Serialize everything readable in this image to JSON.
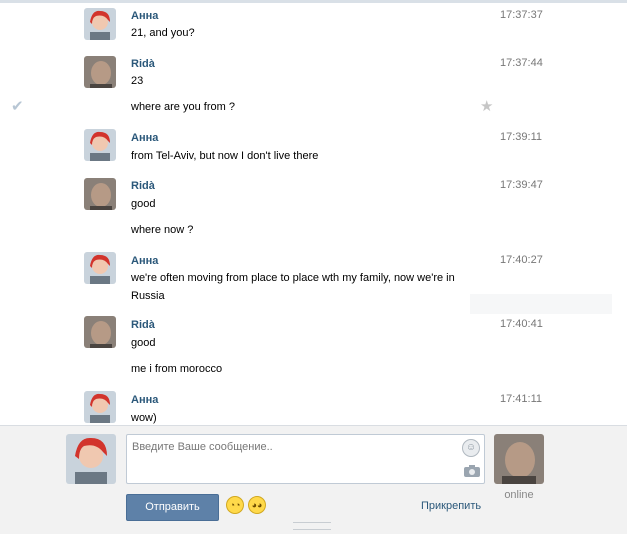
{
  "messages": [
    {
      "name": "Анна",
      "time": "17:37:37",
      "lines": [
        "21, and you?"
      ],
      "avatar": "anna"
    },
    {
      "name": "Ridà",
      "time": "17:37:44",
      "lines": [
        "23"
      ],
      "avatar": "rida"
    },
    {
      "name": "",
      "time": "",
      "lines": [
        "where are you from ?"
      ],
      "avatar": ""
    },
    {
      "name": "Анна",
      "time": "17:39:11",
      "lines": [
        "from Tel-Aviv, but now I don't live there"
      ],
      "avatar": "anna"
    },
    {
      "name": "Ridà",
      "time": "17:39:47",
      "lines": [
        "good"
      ],
      "avatar": "rida"
    },
    {
      "name": "",
      "time": "",
      "lines": [
        "where now ?"
      ],
      "avatar": ""
    },
    {
      "name": "Анна",
      "time": "17:40:27",
      "lines": [
        "we're often moving from place to place wth my family, now we're in Russia"
      ],
      "avatar": "anna"
    },
    {
      "name": "Ridà",
      "time": "17:40:41",
      "lines": [
        "good"
      ],
      "avatar": "rida"
    },
    {
      "name": "",
      "time": "",
      "lines": [
        "me i from morocco"
      ],
      "avatar": ""
    },
    {
      "name": "Анна",
      "time": "17:41:11",
      "lines": [
        "wow)"
      ],
      "avatar": "anna"
    }
  ],
  "composer": {
    "placeholder": "Введите Ваше сообщение..",
    "send_label": "Отправить",
    "attach_label": "Прикрепить",
    "status": "online"
  },
  "icons": {
    "check": "checkmark-icon",
    "star": "star-icon",
    "smile": "smiley-icon",
    "camera": "camera-icon"
  }
}
